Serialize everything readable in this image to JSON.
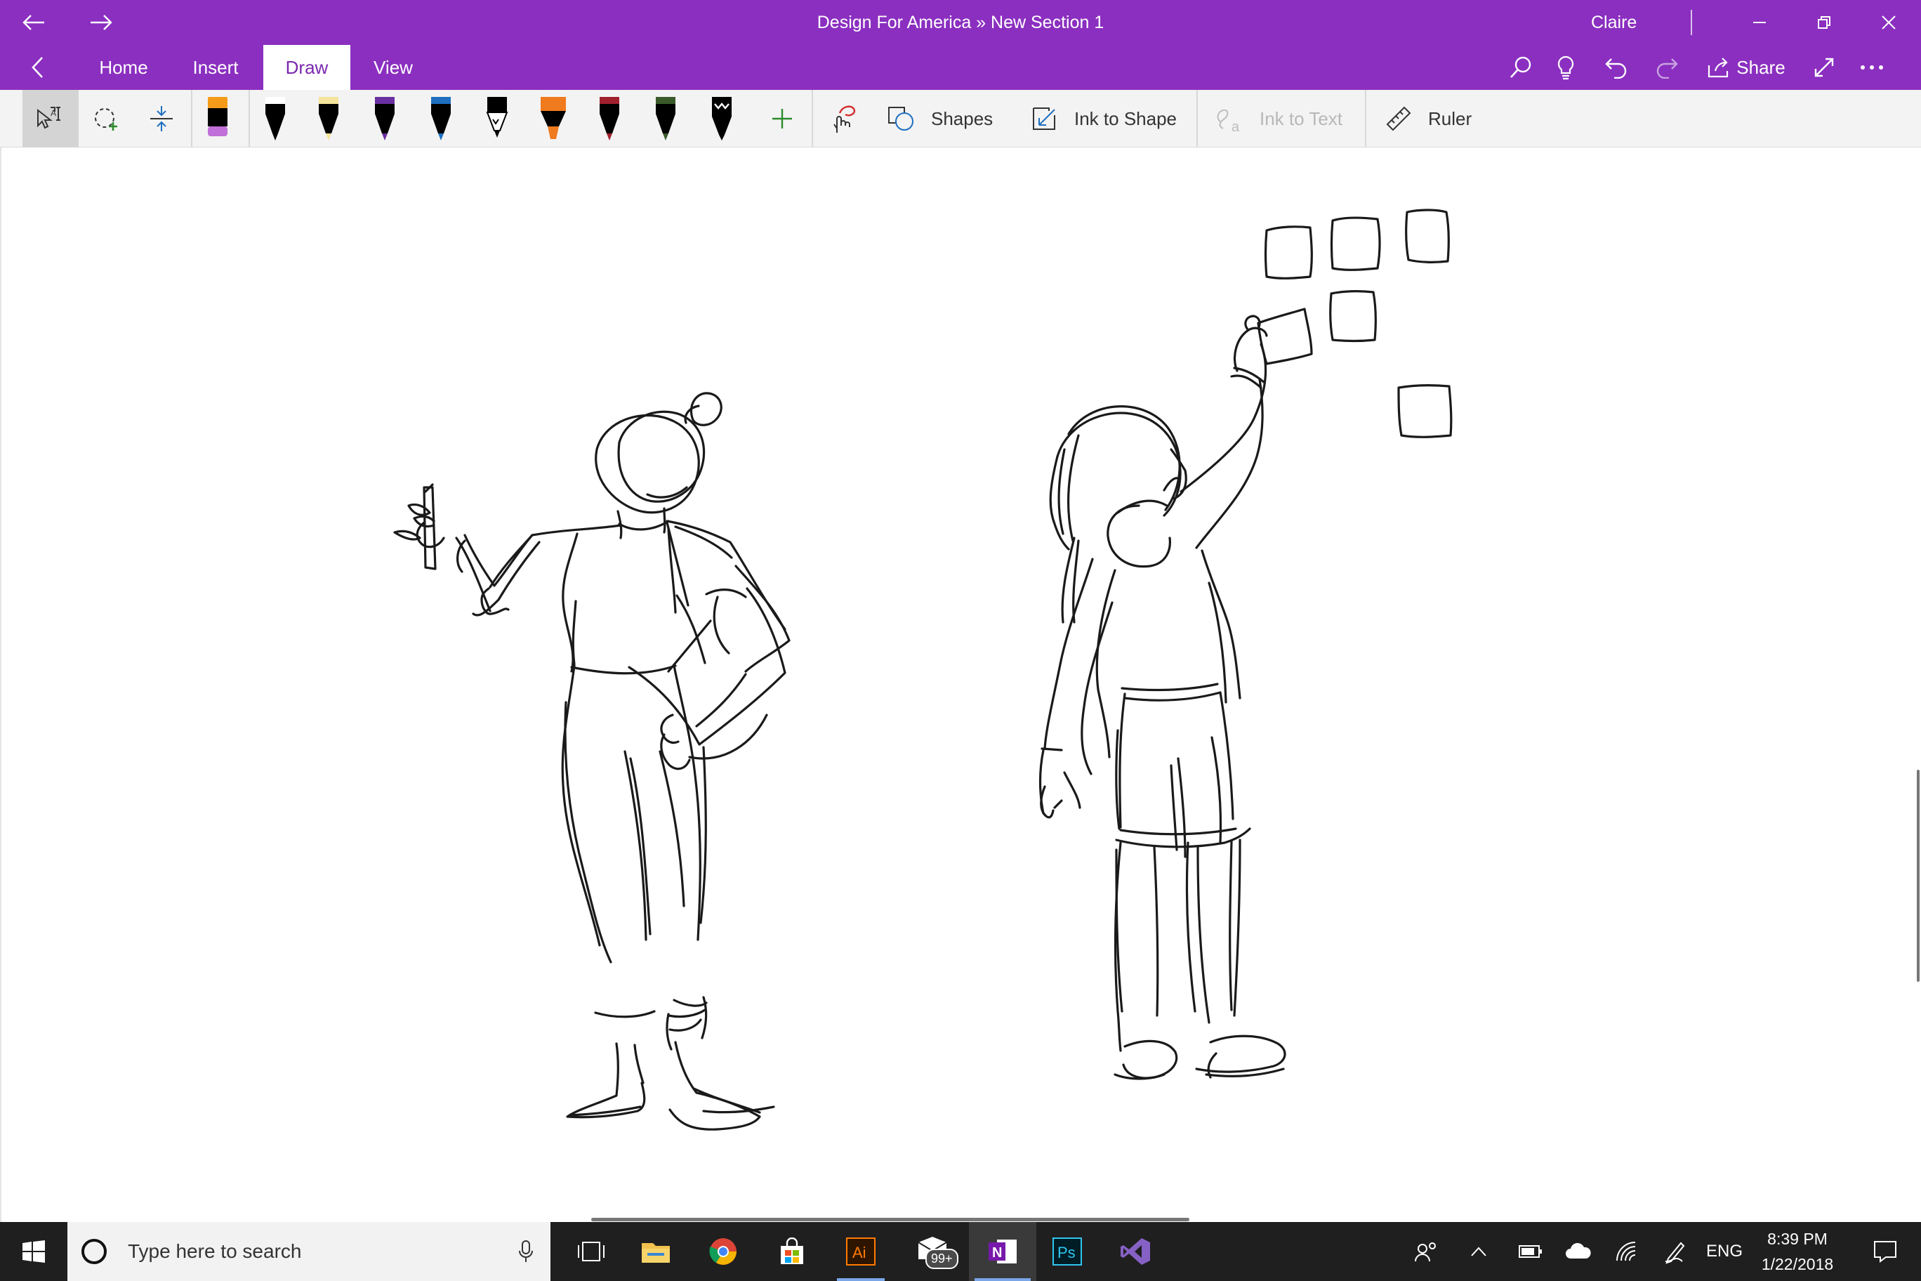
{
  "window": {
    "title": "Design For America » New Section 1",
    "user": "Claire"
  },
  "ribbon": {
    "tabs": [
      {
        "label": "Home",
        "active": false
      },
      {
        "label": "Insert",
        "active": false
      },
      {
        "label": "Draw",
        "active": true
      },
      {
        "label": "View",
        "active": false
      }
    ],
    "share_label": "Share"
  },
  "toolbar": {
    "pens": [
      {
        "name": "highlighter-pen",
        "body": "#000000",
        "tip": "#f59b1a",
        "band": "#c070d8"
      },
      {
        "name": "black-pen",
        "body": "#000000",
        "tip": "#000000",
        "band": "#ffffff"
      },
      {
        "name": "yellow-pen",
        "body": "#000000",
        "tip": "#f4e39a",
        "band": "#f4e39a"
      },
      {
        "name": "purple-pen",
        "body": "#000000",
        "tip": "#6a2fa0",
        "band": "#6a2fa0"
      },
      {
        "name": "blue-pen",
        "body": "#000000",
        "tip": "#1e6fc0",
        "band": "#1e6fc0"
      },
      {
        "name": "pencil",
        "body": "#000000",
        "tip": "#ffffff",
        "band": "#ffffff"
      },
      {
        "name": "orange-highlighter",
        "body": "#000000",
        "tip": "#f07a1e",
        "band": "#f07a1e"
      },
      {
        "name": "red-pen",
        "body": "#000000",
        "tip": "#a0202e",
        "band": "#a0202e"
      },
      {
        "name": "green-pen",
        "body": "#000000",
        "tip": "#3a5a2a",
        "band": "#3a5a2a"
      },
      {
        "name": "galaxy-pen",
        "body": "#000000",
        "tip": "#000000",
        "band": "#000000"
      }
    ],
    "shapes_label": "Shapes",
    "ink_to_shape_label": "Ink to Shape",
    "ink_to_text_label": "Ink to Text",
    "ruler_label": "Ruler"
  },
  "taskbar": {
    "search_placeholder": "Type here to search",
    "notification_badge": "99+",
    "language": "ENG",
    "time": "8:39 PM",
    "date": "1/22/2018"
  },
  "colors": {
    "accent": "#8b2fc0",
    "ink": "#1a1a1a",
    "taskbar": "#1f1f1f"
  }
}
